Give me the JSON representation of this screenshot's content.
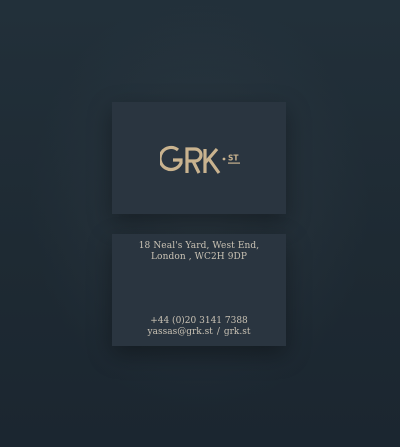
{
  "brand": {
    "logo_text": "GRK",
    "logo_suffix": "ST",
    "color": "#c9b38f"
  },
  "address": {
    "line1": "18 Neal's Yard, West End,",
    "line2": "London , WC2H 9DP"
  },
  "contact": {
    "phone": "+44 (0)20 3141 7388",
    "email": "yassas@grk.st",
    "separator": "/",
    "website": "grk.st"
  }
}
